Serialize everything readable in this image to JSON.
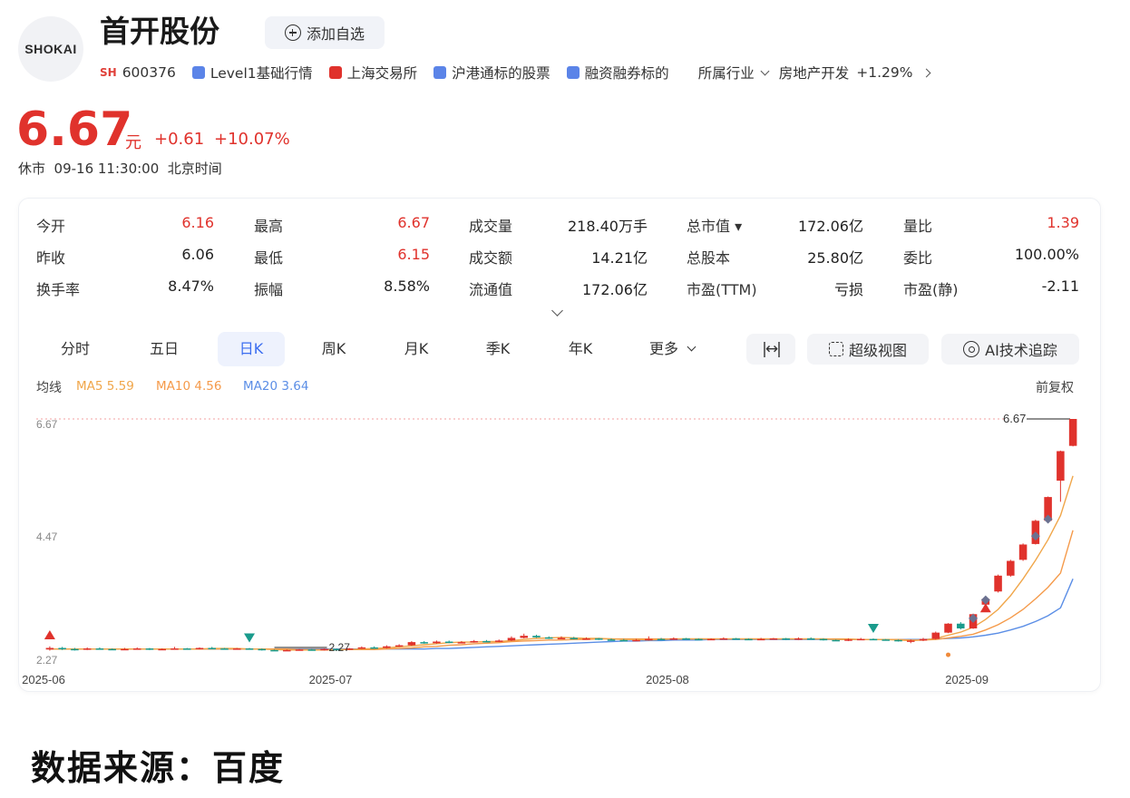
{
  "header": {
    "logo_text": "SHOKAI",
    "stock_name": "首开股份",
    "add_watchlist_label": "添加自选",
    "exchange_badge": "SH",
    "code": "600376",
    "tags": [
      {
        "label": "Level1基础行情",
        "icon": "level1-icon",
        "color": "blue"
      },
      {
        "label": "上海交易所",
        "icon": "sse-icon",
        "color": "red"
      },
      {
        "label": "沪港通标的股票",
        "icon": "hk-connect-icon",
        "color": "blue"
      },
      {
        "label": "融资融券标的",
        "icon": "margin-icon",
        "color": "blue"
      }
    ],
    "industry_label": "所属行业",
    "industry_name": "房地产开发",
    "industry_change": "+1.29%"
  },
  "quote": {
    "price": "6.67",
    "unit": "元",
    "change": "+0.61",
    "change_pct": "+10.07%",
    "status": "休市  09-16 11:30:00  北京时间"
  },
  "stats": [
    {
      "label": "今开",
      "value": "6.16",
      "red": true
    },
    {
      "label": "最高",
      "value": "6.67",
      "red": true
    },
    {
      "label": "成交量",
      "value": "218.40万手",
      "red": false
    },
    {
      "label": "总市值 ▾",
      "value": "172.06亿",
      "red": false
    },
    {
      "label": "量比",
      "value": "1.39",
      "red": true
    },
    {
      "label": "昨收",
      "value": "6.06",
      "red": false
    },
    {
      "label": "最低",
      "value": "6.15",
      "red": true
    },
    {
      "label": "成交额",
      "value": "14.21亿",
      "red": false
    },
    {
      "label": "总股本",
      "value": "25.80亿",
      "red": false
    },
    {
      "label": "委比",
      "value": "100.00%",
      "red": false
    },
    {
      "label": "换手率",
      "value": "8.47%",
      "red": false
    },
    {
      "label": "振幅",
      "value": "8.58%",
      "red": false
    },
    {
      "label": "流通值",
      "value": "172.06亿",
      "red": false
    },
    {
      "label": "市盈(TTM)",
      "value": "亏损",
      "red": false
    },
    {
      "label": "市盈(静)",
      "value": "-2.11",
      "red": false
    }
  ],
  "tabs": [
    "分时",
    "五日",
    "日K",
    "周K",
    "月K",
    "季K",
    "年K",
    "更多"
  ],
  "active_tab": "日K",
  "tools": {
    "super_view": "超级视图",
    "ai_track": "AI技术追踪"
  },
  "ma": {
    "label": "均线",
    "ma5": "MA5 5.59",
    "ma10": "MA10 4.56",
    "ma20": "MA20 3.64",
    "colors": {
      "ma5": "#f0a64a",
      "ma10": "#f59a4a",
      "ma20": "#5b8ee6"
    }
  },
  "adjust_label": "前复权",
  "chart_data": {
    "type": "candlestick",
    "title": "",
    "y_ticks": [
      "6.67",
      "4.47",
      "2.27"
    ],
    "ylim": [
      2.27,
      6.67
    ],
    "x_ticks": [
      "2025-06",
      "2025-07",
      "2025-08",
      "2025-09"
    ],
    "max_label": "6.67",
    "min_label": "2.27",
    "up_color": "#e0322c",
    "down_color": "#1a9b8c",
    "candles": [
      {
        "o": 2.3,
        "c": 2.33,
        "h": 2.36,
        "l": 2.28
      },
      {
        "o": 2.33,
        "c": 2.31,
        "h": 2.35,
        "l": 2.29
      },
      {
        "o": 2.31,
        "c": 2.3,
        "h": 2.33,
        "l": 2.28
      },
      {
        "o": 2.3,
        "c": 2.32,
        "h": 2.34,
        "l": 2.29
      },
      {
        "o": 2.32,
        "c": 2.31,
        "h": 2.34,
        "l": 2.3
      },
      {
        "o": 2.31,
        "c": 2.3,
        "h": 2.32,
        "l": 2.29
      },
      {
        "o": 2.3,
        "c": 2.31,
        "h": 2.33,
        "l": 2.29
      },
      {
        "o": 2.31,
        "c": 2.32,
        "h": 2.34,
        "l": 2.3
      },
      {
        "o": 2.32,
        "c": 2.3,
        "h": 2.33,
        "l": 2.29
      },
      {
        "o": 2.3,
        "c": 2.31,
        "h": 2.32,
        "l": 2.29
      },
      {
        "o": 2.31,
        "c": 2.32,
        "h": 2.35,
        "l": 2.3
      },
      {
        "o": 2.32,
        "c": 2.31,
        "h": 2.33,
        "l": 2.3
      },
      {
        "o": 2.31,
        "c": 2.33,
        "h": 2.34,
        "l": 2.3
      },
      {
        "o": 2.33,
        "c": 2.32,
        "h": 2.35,
        "l": 2.31
      },
      {
        "o": 2.32,
        "c": 2.31,
        "h": 2.33,
        "l": 2.3
      },
      {
        "o": 2.31,
        "c": 2.32,
        "h": 2.33,
        "l": 2.3
      },
      {
        "o": 2.32,
        "c": 2.31,
        "h": 2.33,
        "l": 2.3
      },
      {
        "o": 2.31,
        "c": 2.29,
        "h": 2.32,
        "l": 2.28
      },
      {
        "o": 2.29,
        "c": 2.28,
        "h": 2.3,
        "l": 2.27
      },
      {
        "o": 2.28,
        "c": 2.29,
        "h": 2.3,
        "l": 2.27
      },
      {
        "o": 2.29,
        "c": 2.3,
        "h": 2.31,
        "l": 2.28
      },
      {
        "o": 2.3,
        "c": 2.29,
        "h": 2.31,
        "l": 2.28
      },
      {
        "o": 2.29,
        "c": 2.31,
        "h": 2.32,
        "l": 2.28
      },
      {
        "o": 2.31,
        "c": 2.3,
        "h": 2.32,
        "l": 2.29
      },
      {
        "o": 2.3,
        "c": 2.32,
        "h": 2.33,
        "l": 2.29
      },
      {
        "o": 2.32,
        "c": 2.34,
        "h": 2.36,
        "l": 2.31
      },
      {
        "o": 2.34,
        "c": 2.33,
        "h": 2.36,
        "l": 2.32
      },
      {
        "o": 2.33,
        "c": 2.36,
        "h": 2.38,
        "l": 2.32
      },
      {
        "o": 2.36,
        "c": 2.38,
        "h": 2.4,
        "l": 2.35
      },
      {
        "o": 2.38,
        "c": 2.44,
        "h": 2.46,
        "l": 2.37
      },
      {
        "o": 2.44,
        "c": 2.42,
        "h": 2.46,
        "l": 2.41
      },
      {
        "o": 2.42,
        "c": 2.45,
        "h": 2.47,
        "l": 2.41
      },
      {
        "o": 2.45,
        "c": 2.43,
        "h": 2.47,
        "l": 2.42
      },
      {
        "o": 2.43,
        "c": 2.44,
        "h": 2.46,
        "l": 2.42
      },
      {
        "o": 2.44,
        "c": 2.46,
        "h": 2.48,
        "l": 2.43
      },
      {
        "o": 2.46,
        "c": 2.45,
        "h": 2.48,
        "l": 2.44
      },
      {
        "o": 2.45,
        "c": 2.47,
        "h": 2.49,
        "l": 2.44
      },
      {
        "o": 2.47,
        "c": 2.52,
        "h": 2.55,
        "l": 2.46
      },
      {
        "o": 2.52,
        "c": 2.56,
        "h": 2.6,
        "l": 2.51
      },
      {
        "o": 2.56,
        "c": 2.53,
        "h": 2.58,
        "l": 2.52
      },
      {
        "o": 2.53,
        "c": 2.51,
        "h": 2.55,
        "l": 2.5
      },
      {
        "o": 2.51,
        "c": 2.52,
        "h": 2.55,
        "l": 2.5
      },
      {
        "o": 2.52,
        "c": 2.5,
        "h": 2.54,
        "l": 2.49
      },
      {
        "o": 2.5,
        "c": 2.51,
        "h": 2.53,
        "l": 2.49
      },
      {
        "o": 2.51,
        "c": 2.49,
        "h": 2.52,
        "l": 2.48
      },
      {
        "o": 2.49,
        "c": 2.48,
        "h": 2.51,
        "l": 2.47
      },
      {
        "o": 2.48,
        "c": 2.47,
        "h": 2.5,
        "l": 2.46
      },
      {
        "o": 2.47,
        "c": 2.48,
        "h": 2.5,
        "l": 2.46
      },
      {
        "o": 2.48,
        "c": 2.5,
        "h": 2.55,
        "l": 2.47
      },
      {
        "o": 2.5,
        "c": 2.49,
        "h": 2.52,
        "l": 2.48
      },
      {
        "o": 2.49,
        "c": 2.51,
        "h": 2.53,
        "l": 2.48
      },
      {
        "o": 2.51,
        "c": 2.5,
        "h": 2.52,
        "l": 2.49
      },
      {
        "o": 2.5,
        "c": 2.49,
        "h": 2.51,
        "l": 2.48
      },
      {
        "o": 2.49,
        "c": 2.5,
        "h": 2.51,
        "l": 2.48
      },
      {
        "o": 2.5,
        "c": 2.51,
        "h": 2.53,
        "l": 2.49
      },
      {
        "o": 2.51,
        "c": 2.5,
        "h": 2.52,
        "l": 2.49
      },
      {
        "o": 2.5,
        "c": 2.49,
        "h": 2.51,
        "l": 2.48
      },
      {
        "o": 2.49,
        "c": 2.5,
        "h": 2.52,
        "l": 2.48
      },
      {
        "o": 2.5,
        "c": 2.51,
        "h": 2.52,
        "l": 2.49
      },
      {
        "o": 2.51,
        "c": 2.49,
        "h": 2.52,
        "l": 2.48
      },
      {
        "o": 2.49,
        "c": 2.51,
        "h": 2.53,
        "l": 2.48
      },
      {
        "o": 2.51,
        "c": 2.5,
        "h": 2.53,
        "l": 2.49
      },
      {
        "o": 2.5,
        "c": 2.48,
        "h": 2.51,
        "l": 2.47
      },
      {
        "o": 2.48,
        "c": 2.47,
        "h": 2.49,
        "l": 2.46
      },
      {
        "o": 2.47,
        "c": 2.49,
        "h": 2.51,
        "l": 2.46
      },
      {
        "o": 2.49,
        "c": 2.5,
        "h": 2.52,
        "l": 2.48
      },
      {
        "o": 2.5,
        "c": 2.49,
        "h": 2.51,
        "l": 2.48
      },
      {
        "o": 2.49,
        "c": 2.48,
        "h": 2.5,
        "l": 2.47
      },
      {
        "o": 2.48,
        "c": 2.46,
        "h": 2.49,
        "l": 2.45
      },
      {
        "o": 2.46,
        "c": 2.47,
        "h": 2.49,
        "l": 2.42
      },
      {
        "o": 2.47,
        "c": 2.5,
        "h": 2.52,
        "l": 2.46
      },
      {
        "o": 2.5,
        "c": 2.62,
        "h": 2.64,
        "l": 2.49
      },
      {
        "o": 2.62,
        "c": 2.79,
        "h": 2.8,
        "l": 2.61
      },
      {
        "o": 2.79,
        "c": 2.7,
        "h": 2.82,
        "l": 2.68
      },
      {
        "o": 2.7,
        "c": 2.97,
        "h": 2.98,
        "l": 2.69
      },
      {
        "o": 3.15,
        "c": 3.26,
        "h": 3.28,
        "l": 3.12
      },
      {
        "o": 3.4,
        "c": 3.7,
        "h": 3.72,
        "l": 3.38
      },
      {
        "o": 3.7,
        "c": 3.98,
        "h": 4.0,
        "l": 3.68
      },
      {
        "o": 4.0,
        "c": 4.29,
        "h": 4.31,
        "l": 3.98
      },
      {
        "o": 4.3,
        "c": 4.74,
        "h": 4.76,
        "l": 4.29
      },
      {
        "o": 4.74,
        "c": 5.19,
        "h": 5.2,
        "l": 4.73
      },
      {
        "o": 5.5,
        "c": 6.06,
        "h": 6.07,
        "l": 5.1
      },
      {
        "o": 6.16,
        "c": 6.67,
        "h": 6.67,
        "l": 6.15
      }
    ],
    "ma5": [
      2.31,
      2.31,
      2.31,
      2.31,
      2.31,
      2.31,
      2.31,
      2.31,
      2.31,
      2.31,
      2.31,
      2.31,
      2.31,
      2.32,
      2.32,
      2.32,
      2.31,
      2.31,
      2.3,
      2.29,
      2.29,
      2.29,
      2.29,
      2.3,
      2.3,
      2.31,
      2.32,
      2.33,
      2.35,
      2.37,
      2.39,
      2.41,
      2.43,
      2.44,
      2.44,
      2.45,
      2.45,
      2.47,
      2.49,
      2.51,
      2.52,
      2.53,
      2.52,
      2.51,
      2.51,
      2.5,
      2.49,
      2.49,
      2.48,
      2.49,
      2.5,
      2.5,
      2.5,
      2.5,
      2.5,
      2.5,
      2.5,
      2.5,
      2.5,
      2.5,
      2.5,
      2.5,
      2.5,
      2.49,
      2.49,
      2.49,
      2.49,
      2.49,
      2.48,
      2.47,
      2.48,
      2.51,
      2.57,
      2.63,
      2.72,
      2.87,
      3.06,
      3.32,
      3.64,
      3.99,
      4.38,
      4.84,
      5.59
    ],
    "ma10": [
      2.31,
      2.31,
      2.31,
      2.31,
      2.31,
      2.31,
      2.31,
      2.31,
      2.31,
      2.31,
      2.31,
      2.31,
      2.31,
      2.31,
      2.31,
      2.31,
      2.31,
      2.31,
      2.31,
      2.31,
      2.3,
      2.3,
      2.3,
      2.3,
      2.3,
      2.3,
      2.3,
      2.31,
      2.32,
      2.33,
      2.35,
      2.36,
      2.38,
      2.39,
      2.41,
      2.42,
      2.43,
      2.45,
      2.46,
      2.47,
      2.48,
      2.48,
      2.49,
      2.49,
      2.5,
      2.5,
      2.5,
      2.5,
      2.5,
      2.5,
      2.5,
      2.5,
      2.5,
      2.5,
      2.5,
      2.5,
      2.5,
      2.5,
      2.5,
      2.5,
      2.5,
      2.5,
      2.5,
      2.5,
      2.5,
      2.49,
      2.49,
      2.49,
      2.49,
      2.48,
      2.48,
      2.49,
      2.52,
      2.55,
      2.59,
      2.67,
      2.77,
      2.9,
      3.06,
      3.26,
      3.48,
      3.75,
      4.56
    ],
    "ma20": [
      2.31,
      2.31,
      2.31,
      2.31,
      2.31,
      2.31,
      2.31,
      2.31,
      2.31,
      2.31,
      2.31,
      2.31,
      2.31,
      2.31,
      2.31,
      2.31,
      2.31,
      2.31,
      2.31,
      2.31,
      2.31,
      2.31,
      2.31,
      2.31,
      2.31,
      2.31,
      2.31,
      2.31,
      2.31,
      2.31,
      2.31,
      2.32,
      2.32,
      2.33,
      2.34,
      2.35,
      2.36,
      2.37,
      2.38,
      2.39,
      2.4,
      2.41,
      2.42,
      2.43,
      2.44,
      2.45,
      2.46,
      2.46,
      2.47,
      2.47,
      2.48,
      2.48,
      2.48,
      2.49,
      2.49,
      2.49,
      2.49,
      2.49,
      2.49,
      2.49,
      2.49,
      2.49,
      2.49,
      2.49,
      2.49,
      2.49,
      2.49,
      2.49,
      2.49,
      2.49,
      2.49,
      2.5,
      2.51,
      2.52,
      2.54,
      2.57,
      2.61,
      2.67,
      2.74,
      2.83,
      2.94,
      3.09,
      3.64
    ],
    "markers": [
      {
        "shape": "triangle-up",
        "color": "#e0322c",
        "index": 0,
        "value": 2.58
      },
      {
        "shape": "triangle-down",
        "color": "#1a9b8c",
        "index": 16,
        "value": 2.52
      },
      {
        "shape": "triangle-down",
        "color": "#1a9b8c",
        "index": 66,
        "value": 2.7
      },
      {
        "shape": "triangle-up",
        "color": "#e0322c",
        "index": 75,
        "value": 3.09
      },
      {
        "shape": "diamond",
        "color": "#6b7190",
        "index": 74,
        "value": 2.89
      },
      {
        "shape": "diamond",
        "color": "#6b7190",
        "index": 75,
        "value": 3.24
      },
      {
        "shape": "diamond",
        "color": "#6b7190",
        "index": 79,
        "value": 4.45
      },
      {
        "shape": "diamond",
        "color": "#6b7190",
        "index": 80,
        "value": 4.77
      },
      {
        "shape": "dot",
        "color": "#f08a3a",
        "index": 72,
        "value": 2.2
      }
    ]
  },
  "footer": {
    "source": "数据来源：百度"
  }
}
